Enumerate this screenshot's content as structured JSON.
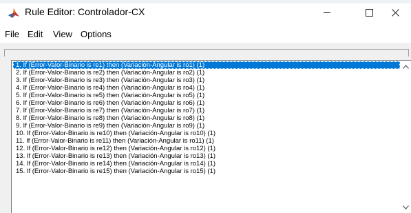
{
  "window": {
    "title": "Rule Editor: Controlador-CX",
    "icons": {
      "app": "matlab-icon",
      "minimize": "minimize-icon",
      "maximize": "maximize-icon",
      "close": "close-icon"
    }
  },
  "menu": {
    "items": [
      "File",
      "Edit",
      "View",
      "Options"
    ]
  },
  "rules": {
    "selected_index": 0,
    "items": [
      "1. If (Error-Valor-Binario is re1) then (Variación-Angular is ro1) (1)",
      "2. If (Error-Valor-Binario is re2) then (Variación-Angular is ro2) (1)",
      "3. If (Error-Valor-Binario is re3) then (Variación-Angular is ro3) (1)",
      "4. If (Error-Valor-Binario is re4) then (Variación-Angular is ro4) (1)",
      "5. If (Error-Valor-Binario is re5) then (Variación-Angular is ro5) (1)",
      "6. If (Error-Valor-Binario is re6) then (Variación-Angular is ro6) (1)",
      "7. If (Error-Valor-Binario is re7) then (Variación-Angular is ro7) (1)",
      "8. If (Error-Valor-Binario is re8) then (Variación-Angular is ro8) (1)",
      "9. If (Error-Valor-Binario is re9) then (Variación-Angular is ro9) (1)",
      "10. If (Error-Valor-Binario is re10) then (Variación-Angular is ro10) (1)",
      "11. If (Error-Valor-Binario is re11) then (Variación-Angular is ro11) (1)",
      "12. If (Error-Valor-Binario is re12) then (Variación-Angular is ro12) (1)",
      "13. If (Error-Valor-Binario is re13) then (Variación-Angular is ro13) (1)",
      "14. If (Error-Valor-Binario is re14) then (Variación-Angular is ro14) (1)",
      "15. If (Error-Valor-Binario is re15) then (Variación-Angular is ro15) (1)"
    ]
  },
  "scrollbar": {
    "up_icon": "chevron-up-icon",
    "down_icon": "chevron-down-icon"
  },
  "colors": {
    "selection": "#0078d7",
    "client_background": "#f0f0f0"
  }
}
